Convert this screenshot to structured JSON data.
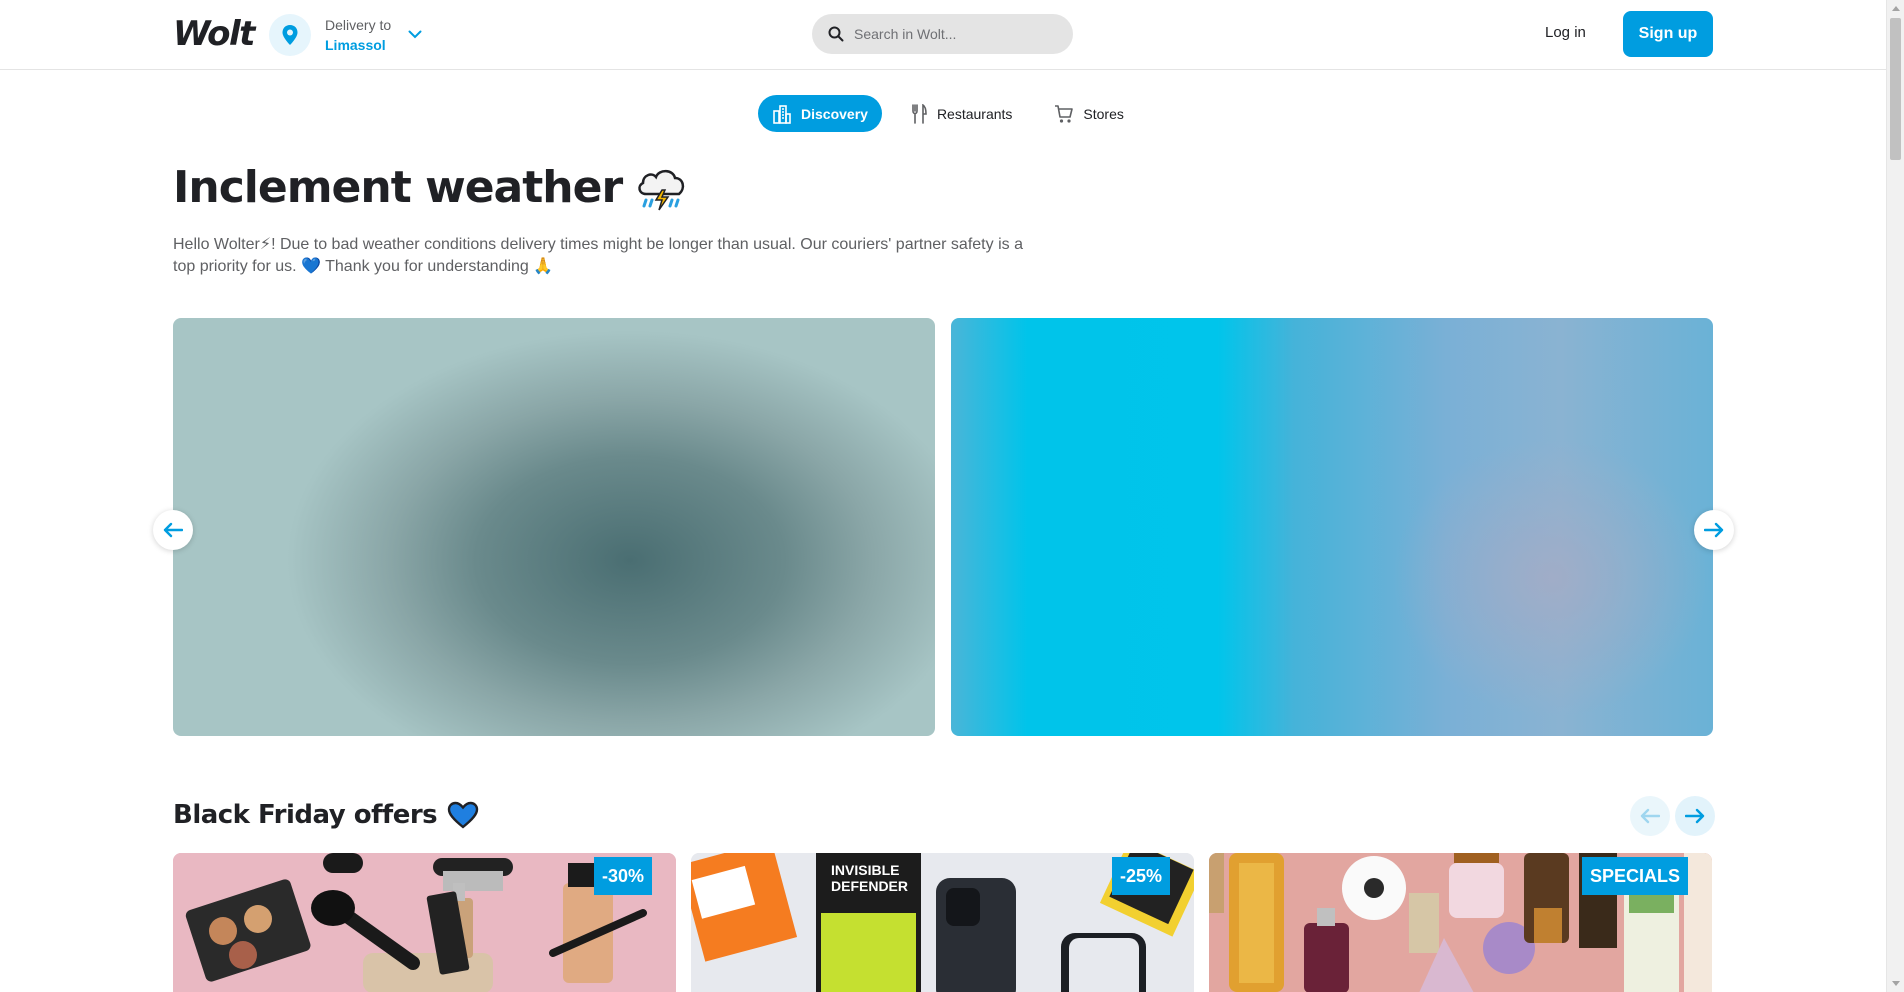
{
  "header": {
    "logo": "Wolt",
    "delivery_label": "Delivery to",
    "delivery_city": "Limassol",
    "search_placeholder": "Search in Wolt...",
    "login": "Log in",
    "signup": "Sign up"
  },
  "tabs": [
    {
      "label": "Discovery",
      "icon": "city-icon",
      "active": true
    },
    {
      "label": "Restaurants",
      "icon": "fork-knife-icon",
      "active": false
    },
    {
      "label": "Stores",
      "icon": "cart-icon",
      "active": false
    }
  ],
  "hero": {
    "title": "Inclement weather",
    "text": "Hello Wolter⚡! Due to bad weather conditions delivery times might be longer than usual. Our couriers' partner safety is a top priority for us. 💙 Thank you for understanding 🙏"
  },
  "section": {
    "title": "Black Friday offers"
  },
  "cards": [
    {
      "badge": "-30%",
      "theme": "cosmetics"
    },
    {
      "badge": "-25%",
      "theme": "phone-cases"
    },
    {
      "badge": "SPECIALS",
      "theme": "perfumes"
    }
  ],
  "colors": {
    "brand": "#009de0",
    "text": "#202125",
    "muted": "#5f6063"
  }
}
